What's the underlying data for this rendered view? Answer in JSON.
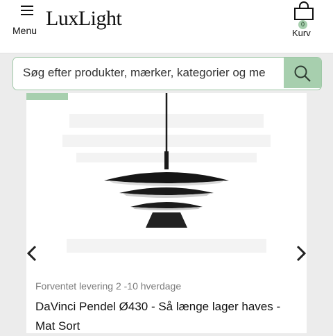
{
  "header": {
    "menu_label": "Menu",
    "logo_text": "LuxLight",
    "cart_label": "Kurv",
    "cart_count": "0",
    "accent_color": "#a7cfae"
  },
  "search": {
    "placeholder": "Søg efter produkter, mærker, kategorier og me"
  },
  "product": {
    "delivery": "Forventet levering 2 -10 hverdage",
    "title": "DaVinci Pendel Ø430 - Så længe lager haves - Mat Sort"
  },
  "icons": {
    "menu": "hamburger-icon",
    "cart": "shopping-bag-icon",
    "search": "magnifier-icon",
    "prev": "chevron-left-icon",
    "next": "chevron-right-icon"
  }
}
